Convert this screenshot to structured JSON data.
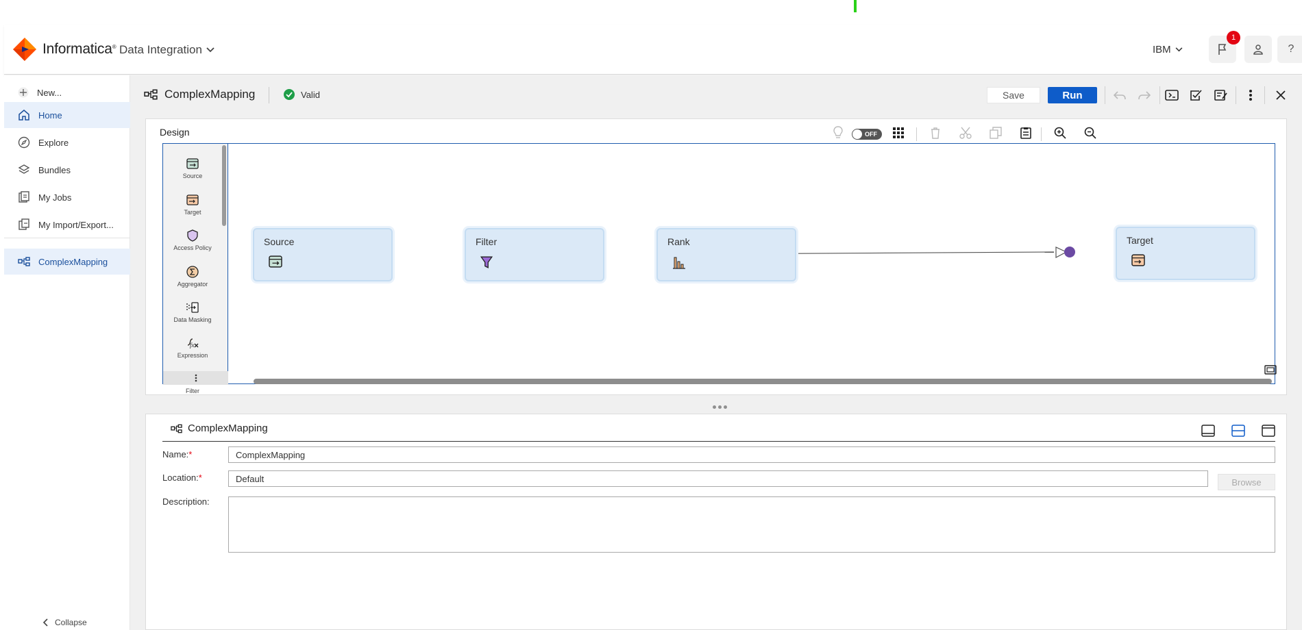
{
  "header": {
    "brand": "Informatica",
    "brand_mark": "®",
    "product": "Data Integration",
    "org": "IBM",
    "notification_count": "1",
    "help_label": "?"
  },
  "sidebar": {
    "new_label": "New...",
    "items": [
      {
        "label": "Home",
        "icon": "home-icon"
      },
      {
        "label": "Explore",
        "icon": "compass-icon"
      },
      {
        "label": "Bundles",
        "icon": "layers-icon"
      },
      {
        "label": "My Jobs",
        "icon": "jobs-icon"
      },
      {
        "label": "My Import/Export..."
      }
    ],
    "open_item": "ComplexMapping",
    "collapse_label": "Collapse"
  },
  "toolbar": {
    "mapping_name": "ComplexMapping",
    "status": "Valid",
    "save_label": "Save",
    "run_label": "Run"
  },
  "design": {
    "title": "Design",
    "toggle_label": "OFF",
    "palette": [
      "Source",
      "Target",
      "Access Policy",
      "Aggregator",
      "Data Masking",
      "Expression",
      "Filter"
    ],
    "nodes": [
      {
        "label": "Source",
        "icon": "source-icon"
      },
      {
        "label": "Filter",
        "icon": "filter-icon"
      },
      {
        "label": "Rank",
        "icon": "rank-icon"
      },
      {
        "label": "Target",
        "icon": "target-icon"
      }
    ]
  },
  "properties": {
    "title": "ComplexMapping",
    "name_label": "Name:",
    "name_value": "ComplexMapping",
    "location_label": "Location:",
    "location_value": "Default",
    "browse_label": "Browse",
    "description_label": "Description:",
    "description_value": ""
  },
  "colors": {
    "accent": "#0e5cc9",
    "node_fill": "#dbe9f7",
    "port": "#6b4aa3",
    "valid": "#1e9e48",
    "badge": "#e30613"
  }
}
